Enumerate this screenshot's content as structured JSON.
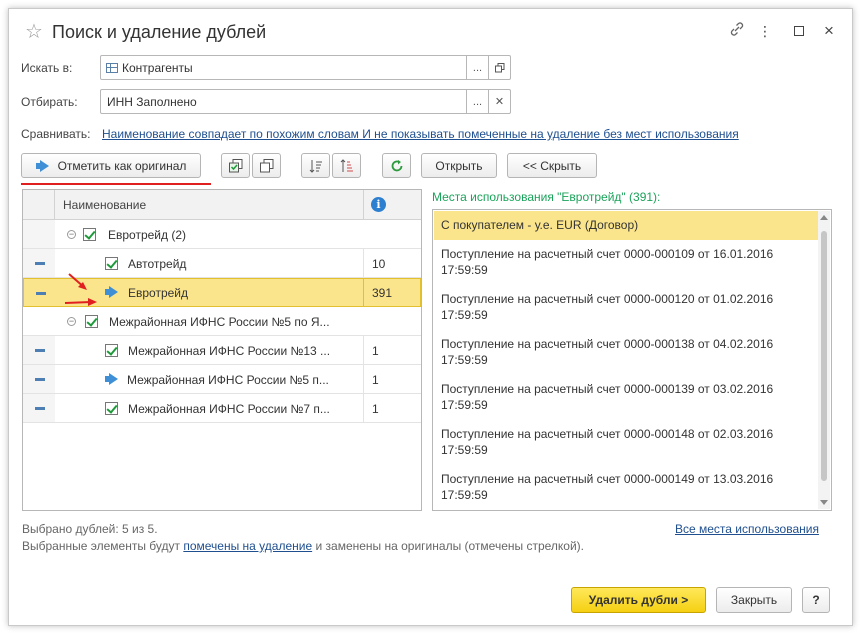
{
  "window": {
    "title": "Поиск и удаление дублей"
  },
  "form": {
    "search_in_label": "Искать в:",
    "search_in_value": "Контрагенты",
    "filter_label": "Отбирать:",
    "filter_value": "ИНН Заполнено",
    "compare_label": "Сравнивать:",
    "compare_link": "Наименование совпадает по похожим словам И не показывать помеченные на удаление без мест использования",
    "dots": "..."
  },
  "toolbar": {
    "mark_original": "Отметить как оригинал",
    "open": "Открыть",
    "hide": "<< Скрыть"
  },
  "tree": {
    "header_name": "Наименование",
    "rows": [
      {
        "name": "Евротрейд (2)",
        "count": ""
      },
      {
        "name": "Автотрейд",
        "count": "10"
      },
      {
        "name": "Евротрейд",
        "count": "391"
      },
      {
        "name": "Межрайонная ИФНС России №5 по Я...",
        "count": ""
      },
      {
        "name": "Межрайонная ИФНС России №13 ...",
        "count": "1"
      },
      {
        "name": "Межрайонная ИФНС России №5 п...",
        "count": "1"
      },
      {
        "name": "Межрайонная ИФНС России №7 п...",
        "count": "1"
      }
    ]
  },
  "usage": {
    "title": "Места использования \"Евротрейд\" (391):",
    "items": [
      "С покупателем - у.е. EUR (Договор)",
      "Поступление на расчетный счет 0000-000109 от 16.01.2016 17:59:59",
      "Поступление на расчетный счет 0000-000120 от 01.02.2016 17:59:59",
      "Поступление на расчетный счет 0000-000138 от 04.02.2016 17:59:59",
      "Поступление на расчетный счет 0000-000139 от 03.02.2016 17:59:59",
      "Поступление на расчетный счет 0000-000148 от 02.03.2016 17:59:59",
      "Поступление на расчетный счет 0000-000149 от 13.03.2016 17:59:59"
    ],
    "all_link": "Все места использования"
  },
  "footer": {
    "selected_text": "Выбрано дублей: 5 из 5.",
    "note_before": "Выбранные элементы будут ",
    "note_link": "помечены на удаление",
    "note_after": " и заменены на оригиналы (отмечены стрелкой).",
    "delete_btn": "Удалить дубли >",
    "close_btn": "Закрыть",
    "help_btn": "?"
  },
  "colors": {
    "accent_yellow": "#f5cf12",
    "selection": "#fbe58c",
    "link": "#1f4f8f",
    "usage_title": "#1aa35a",
    "annotation_red": "#e02020"
  }
}
